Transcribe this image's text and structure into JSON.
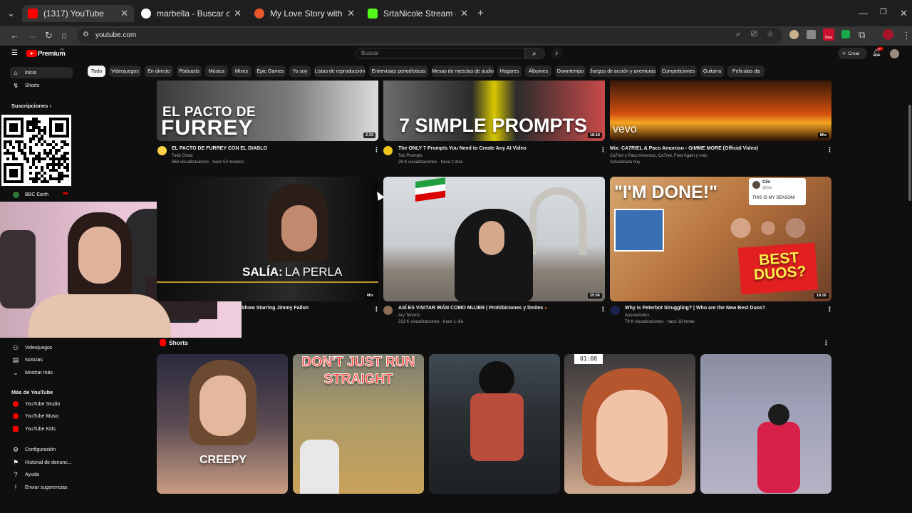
{
  "browser": {
    "tabs": [
      {
        "title": "(1317) YouTube",
        "color": "#ff0000"
      },
      {
        "title": "marbella - Buscar con Google",
        "color": "#4285f4"
      },
      {
        "title": "My Love Story with Yamada-ku",
        "color": "#e8572c"
      },
      {
        "title": "SrtaNicole Stream - Watch Live",
        "color": "#53fc18"
      }
    ],
    "new_tab": "+",
    "url": "youtube.com",
    "ext_badge": "New"
  },
  "youtube": {
    "logo": "Premium",
    "logo_sup": "PE",
    "search_placeholder": "Buscar",
    "create_label": "Crear",
    "notif_count": "9+",
    "chips": [
      "Todo",
      "Videojuegos",
      "En directo",
      "Pódcasts",
      "Música",
      "Mixes",
      "Epic Games",
      "Yo soy",
      "Listas de reproducción",
      "Entrevistas periodísticas",
      "Mesas de mezclas de audio",
      "Hogares",
      "Álbumes",
      "Downtempo",
      "Juegos de acción y aventuras",
      "Competiciones",
      "Guitarra",
      "Películas de"
    ]
  },
  "sidebar": {
    "top": [
      {
        "label": "Inicio"
      },
      {
        "label": "Shorts"
      }
    ],
    "subs_heading": "Suscripciones",
    "channel": "BBC Earth",
    "explore": [
      {
        "label": "Videojuegos"
      },
      {
        "label": "Noticias"
      },
      {
        "label": "Mostrar más"
      }
    ],
    "more_heading": "Más de YouTube",
    "more": [
      {
        "label": "YouTube Studio"
      },
      {
        "label": "YouTube Music"
      },
      {
        "label": "YouTube Kids"
      }
    ],
    "footer": [
      {
        "label": "Configuración"
      },
      {
        "label": "Historial de denunc..."
      },
      {
        "label": "Ayuda"
      },
      {
        "label": "Enviar sugerencias"
      }
    ]
  },
  "videos": [
    {
      "title": "EL PACTO DE FURREY CON EL DIABLO",
      "channel": "Todo Good",
      "meta": "568 visualizaciones · hace 53 minutos",
      "duration": "2:33",
      "thumb_text_1": "EL PACTO DE",
      "thumb_text_2": "FURREY"
    },
    {
      "title": "The ONLY 7 Prompts You Need to Create Any AI Video",
      "channel": "Tao Prompts",
      "meta": "28 K visualizaciones · hace 2 días",
      "duration": "18:18",
      "thumb_text_1": "7 SIMPLE PROMPTS"
    },
    {
      "title": "Mix: CA7RIEL & Paco Amoroso - GIMME MORE (Official Video)",
      "channel": "Ca7riel y Paco Amoroso, Ca7riel, Fred Again y más",
      "meta": "Actualizada hoy",
      "duration": "Mix",
      "thumb_text_1": "vevo"
    },
    {
      "title": "Show Starring Jimmy Fallon",
      "channel": "",
      "meta": "",
      "duration": "Mix",
      "thumb_text_1": "SALÍA:",
      "thumb_text_2": "LA PERLA"
    },
    {
      "title": "ASÍ ES VISITAR IRÁN COMO MUJER | Prohibiciones y límites",
      "channel": "Ary Tenorio",
      "meta": "313 K visualizaciones · hace 1 día",
      "duration": "25:56"
    },
    {
      "title": "Why is Peterbot Struggling? | Who are the New Best Duos?",
      "channel": "AussieAntics",
      "meta": "79 K visualizaciones · hace 18 horas",
      "duration": "18:26",
      "thumb_text_1": "\"I'M DONE!\"",
      "thumb_text_2": "BEST DUOS?",
      "tweet_name": "Clix",
      "tweet_handle": "@Clix",
      "tweet_text": "THIS IS MY SEASON!"
    }
  ],
  "shorts": {
    "heading": "Shorts",
    "items": [
      {
        "overlay": "CREEPY"
      },
      {
        "overlay": "DON'T JUST RUN STRAIGHT"
      },
      {
        "overlay": ""
      },
      {
        "overlay": "01:08"
      },
      {
        "overlay": ""
      }
    ]
  }
}
